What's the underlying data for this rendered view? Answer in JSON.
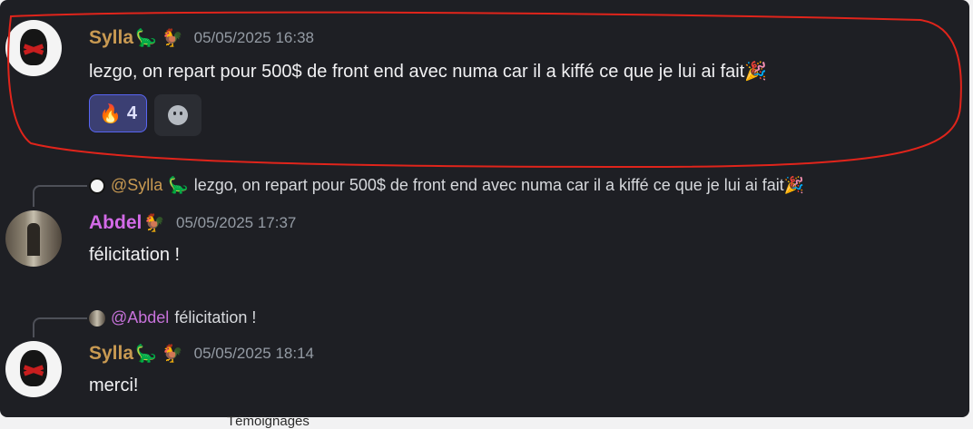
{
  "messages": [
    {
      "username": "Sylla",
      "badges": "🦕 🐓",
      "timestamp": "05/05/2025 16:38",
      "text": "lezgo, on repart pour 500$ de front end avec numa car il a kiffé ce que je lui ai fait🎉",
      "reaction": {
        "emoji": "🔥",
        "count": "4"
      }
    },
    {
      "reply": {
        "mention": "@Sylla",
        "mention_emoji": "🦕",
        "text": "lezgo, on repart pour 500$ de front end avec numa car il a kiffé ce que je lui ai fait🎉"
      },
      "username": "Abdel",
      "badges": "🐓",
      "timestamp": "05/05/2025 17:37",
      "text": "félicitation !"
    },
    {
      "reply": {
        "mention": "@Abdel",
        "text": "félicitation !"
      },
      "username": "Sylla",
      "badges": "🦕 🐓",
      "timestamp": "05/05/2025 18:14",
      "text": "merci!"
    }
  ],
  "below_text": "Témoignages",
  "colors": {
    "background": "#1e1f24",
    "sylla_name": "#c99a52",
    "abdel_name": "#d36ae7",
    "highlight": "#e0241b"
  }
}
